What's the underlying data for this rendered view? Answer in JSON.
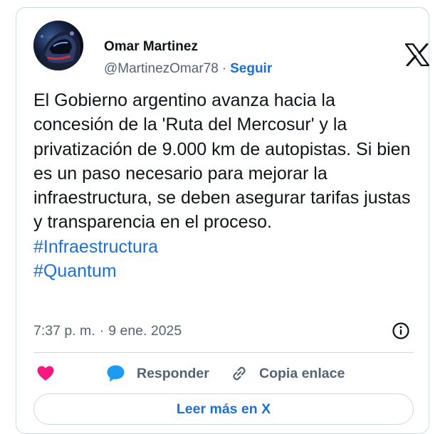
{
  "author": {
    "name": "Omar Martinez",
    "handle": "@MartinezOmar78",
    "separator": "·",
    "follow_label": "Seguir",
    "avatar_icon": "profile-photo-helmet"
  },
  "brand": {
    "logo_icon": "x-logo"
  },
  "tweet": {
    "text": "El Gobierno argentino avanza hacia la concesión de la 'Ruta del Mercosur' y la privatización de 9.000 km de autopistas. Si bien es un paso necesario para mejorar la infraestructura, se deben asegurar tarifas justas y transparencia en el proceso.",
    "hashtags": [
      "#Infraestructura",
      "#Quantum"
    ]
  },
  "meta": {
    "time": "7:37 p. m.",
    "separator": "·",
    "date": "9 ene. 2025",
    "info_icon": "info-icon"
  },
  "actions": {
    "like_icon": "heart-icon",
    "reply_label": "Responder",
    "reply_icon": "reply-bubble-icon",
    "copy_label": "Copia enlace",
    "copy_icon": "link-icon"
  },
  "read_more": {
    "label": "Leer más en X"
  },
  "colors": {
    "link": "#1d6fd1",
    "like": "#f91880",
    "reply": "#1d9bf0",
    "secondary_text": "#536471",
    "border": "#cfd9de"
  }
}
